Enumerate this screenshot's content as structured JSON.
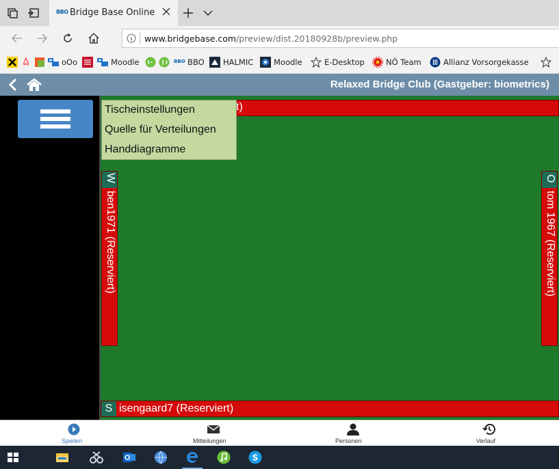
{
  "browser": {
    "tab_title": "Bridge Base Online",
    "tab_favicon_text": "BBO",
    "url_host": "www.bridgebase.com",
    "url_path": "/preview/dist.20180928b/preview.php"
  },
  "favorites": [
    {
      "label": "oOo",
      "icon": "ooo-icon"
    },
    {
      "label": "Moodle",
      "icon": "moodle-icon"
    },
    {
      "label": "BBO",
      "icon": "bbo-icon"
    },
    {
      "label": "HALMIC",
      "icon": "halmic-icon"
    },
    {
      "label": "Moodle",
      "icon": "moodle-icon"
    },
    {
      "label": "E-Desktop",
      "icon": "star-icon"
    },
    {
      "label": "NÖ Team",
      "icon": "gear-icon"
    },
    {
      "label": "Allianz Vorsorgekasse",
      "icon": "allianz-icon"
    }
  ],
  "header": {
    "club_title": "Relaxed Bridge Club (Gastgeber: biometrics)"
  },
  "menu": {
    "items": [
      "Tischeinstellungen",
      "Quelle für Verteilungen",
      "Handdiagramme"
    ]
  },
  "table": {
    "north_visible_text": "t)",
    "west": {
      "seat": "W",
      "player": "ben1971 (Reserviert)"
    },
    "east": {
      "seat": "O",
      "player": "tom 1967 (Reserviert)"
    },
    "south": {
      "seat": "S",
      "player": "isengaard7 (Reserviert)"
    }
  },
  "bottom_nav": [
    {
      "label": "Spielen",
      "icon": "play-icon",
      "active": true
    },
    {
      "label": "Mitteilungen",
      "icon": "envelope-icon",
      "active": false
    },
    {
      "label": "Personen",
      "icon": "person-icon",
      "active": false
    },
    {
      "label": "Verlauf",
      "icon": "history-icon",
      "active": false
    }
  ],
  "colors": {
    "header_bg": "#6e8ea8",
    "table_green": "#1e7a2a",
    "seat_red": "#d60a0a",
    "seat_label_green": "#1e6b56",
    "menu_bg": "#c4d9a0",
    "menu_button_blue": "#4786c6",
    "nav_active": "#3a78b8"
  }
}
